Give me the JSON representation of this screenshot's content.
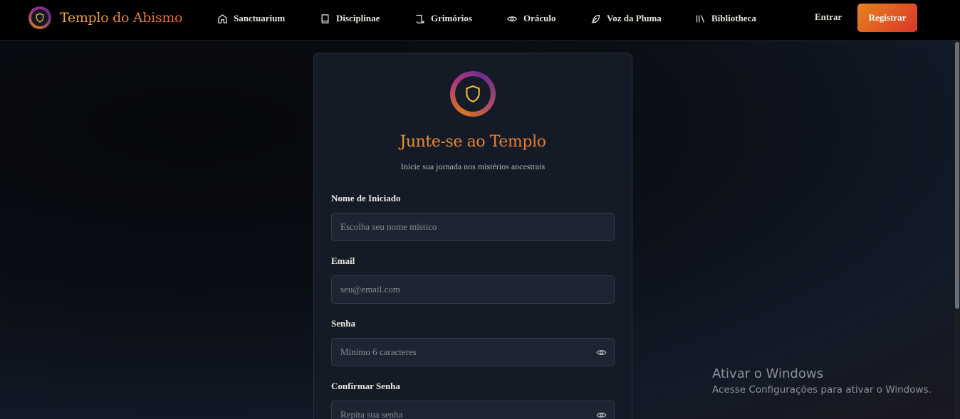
{
  "nav": {
    "brand": "Templo do Abismo",
    "items": [
      {
        "label": "Sanctuarium",
        "icon": "home-icon"
      },
      {
        "label": "Disciplinae",
        "icon": "book-icon"
      },
      {
        "label": "Grimórios",
        "icon": "scroll-icon"
      },
      {
        "label": "Oráculo",
        "icon": "eye-icon"
      },
      {
        "label": "Voz da Pluma",
        "icon": "feather-icon"
      },
      {
        "label": "Bibliotheca",
        "icon": "library-icon"
      }
    ],
    "login_label": "Entrar",
    "register_label": "Registrar"
  },
  "card": {
    "emblem_icon": "shield-icon",
    "title": "Junte-se ao Templo",
    "subtitle": "Inicie sua jornada nos mistérios ancestrais",
    "fields": [
      {
        "label": "Nome de Iniciado",
        "placeholder": "Escolha seu nome místico",
        "value": ""
      },
      {
        "label": "Email",
        "placeholder": "seu@email.com",
        "value": ""
      },
      {
        "label": "Senha",
        "placeholder": "Mínimo 6 caracteres",
        "value": ""
      },
      {
        "label": "Confirmar Senha",
        "placeholder": "Repita sua senha",
        "value": ""
      }
    ]
  },
  "watermark": {
    "title": "Ativar o Windows",
    "subtitle": "Acesse Configurações para ativar o Windows."
  },
  "colors": {
    "accent_orange": "#f0a33a",
    "accent_red": "#d9352b",
    "card_bg": "#151b26",
    "input_bg": "#1e2532"
  }
}
